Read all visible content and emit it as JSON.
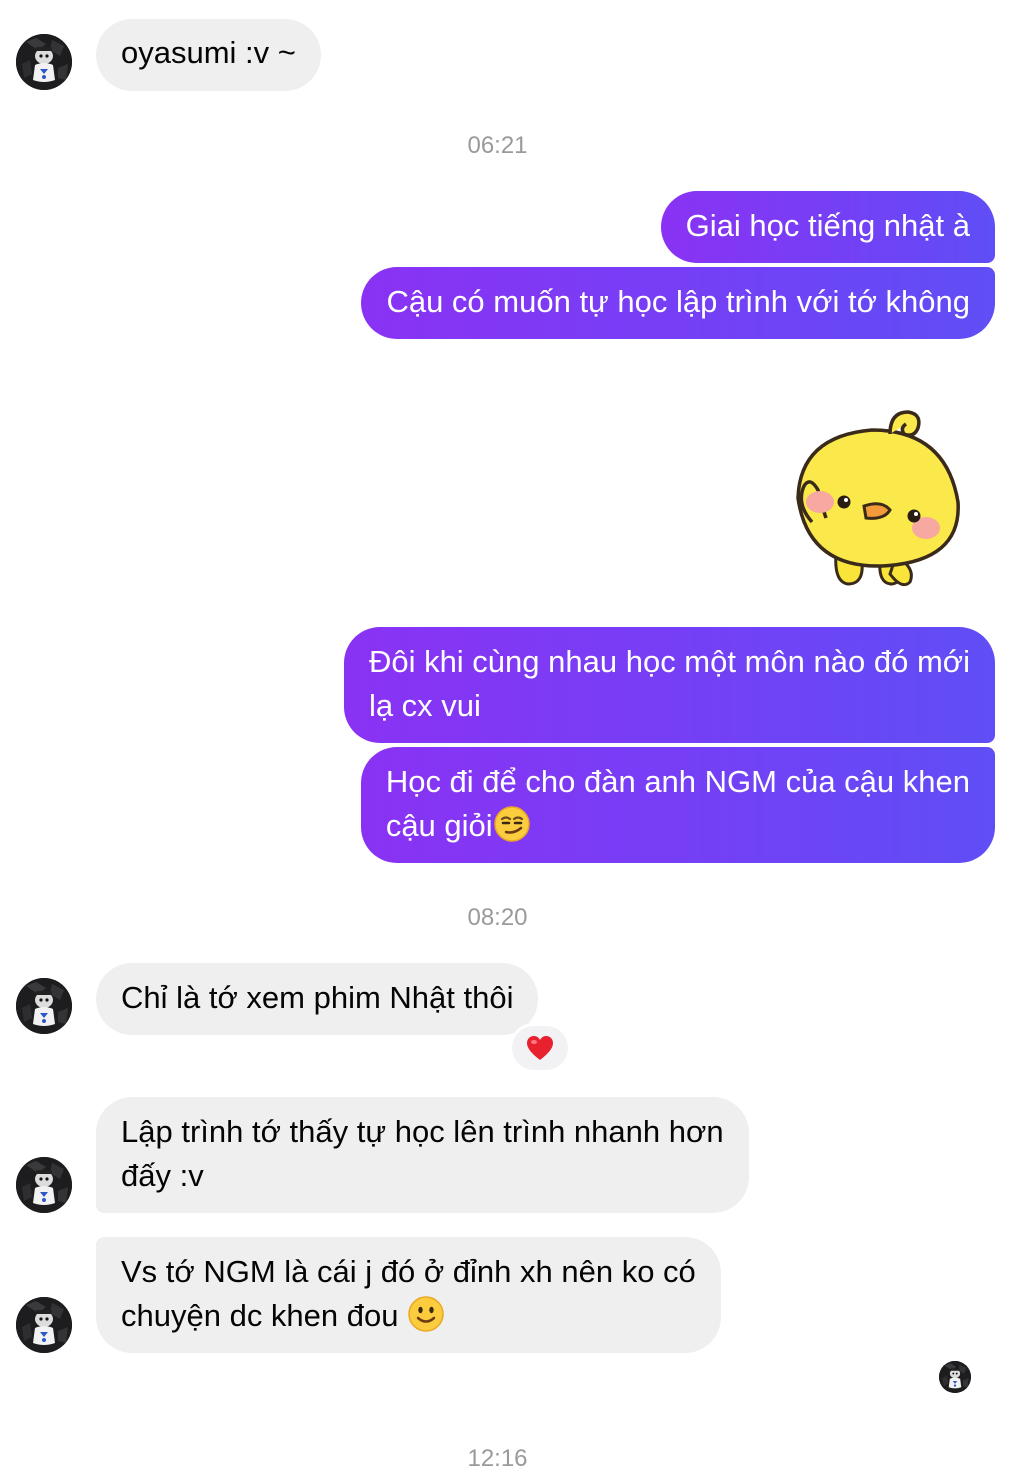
{
  "conversation": {
    "messages": [
      {
        "text": "oyasumi :v ~"
      },
      {
        "text": "Giai học tiếng nhật à"
      },
      {
        "text": "Cậu có muốn tự học lập trình với tớ không"
      },
      {
        "line1": "Đôi khi cùng nhau học một môn nào đó mới",
        "line2": "lạ cx vui"
      },
      {
        "line1": "Học đi để cho đàn anh NGM của cậu khen",
        "line2": "cậu giỏi"
      },
      {
        "text": "Chỉ là tớ xem phim Nhật thôi"
      },
      {
        "line1": "Lập trình tớ thấy tự học lên trình nhanh hơn",
        "line2": "đấy :v"
      },
      {
        "line1": "Vs tớ NGM là cái j đó ở đỉnh xh nên ko có",
        "line2": "chuyện dc khen đou"
      }
    ],
    "timestamps": [
      "06:21",
      "08:20",
      "12:16"
    ]
  },
  "icons": {
    "sticker": "yellow-chick-waving-sticker",
    "smirk": "smirking-face-emoji",
    "smile": "slightly-smiling-face-emoji",
    "reaction": "red-heart-emoji",
    "avatar": "contact-avatar"
  },
  "colors": {
    "outgoing_bubble_start": "#8a32f4",
    "outgoing_bubble_end": "#5f4ef6",
    "incoming_bubble": "#efeff0",
    "timestamp_text": "#9a9a9a"
  }
}
